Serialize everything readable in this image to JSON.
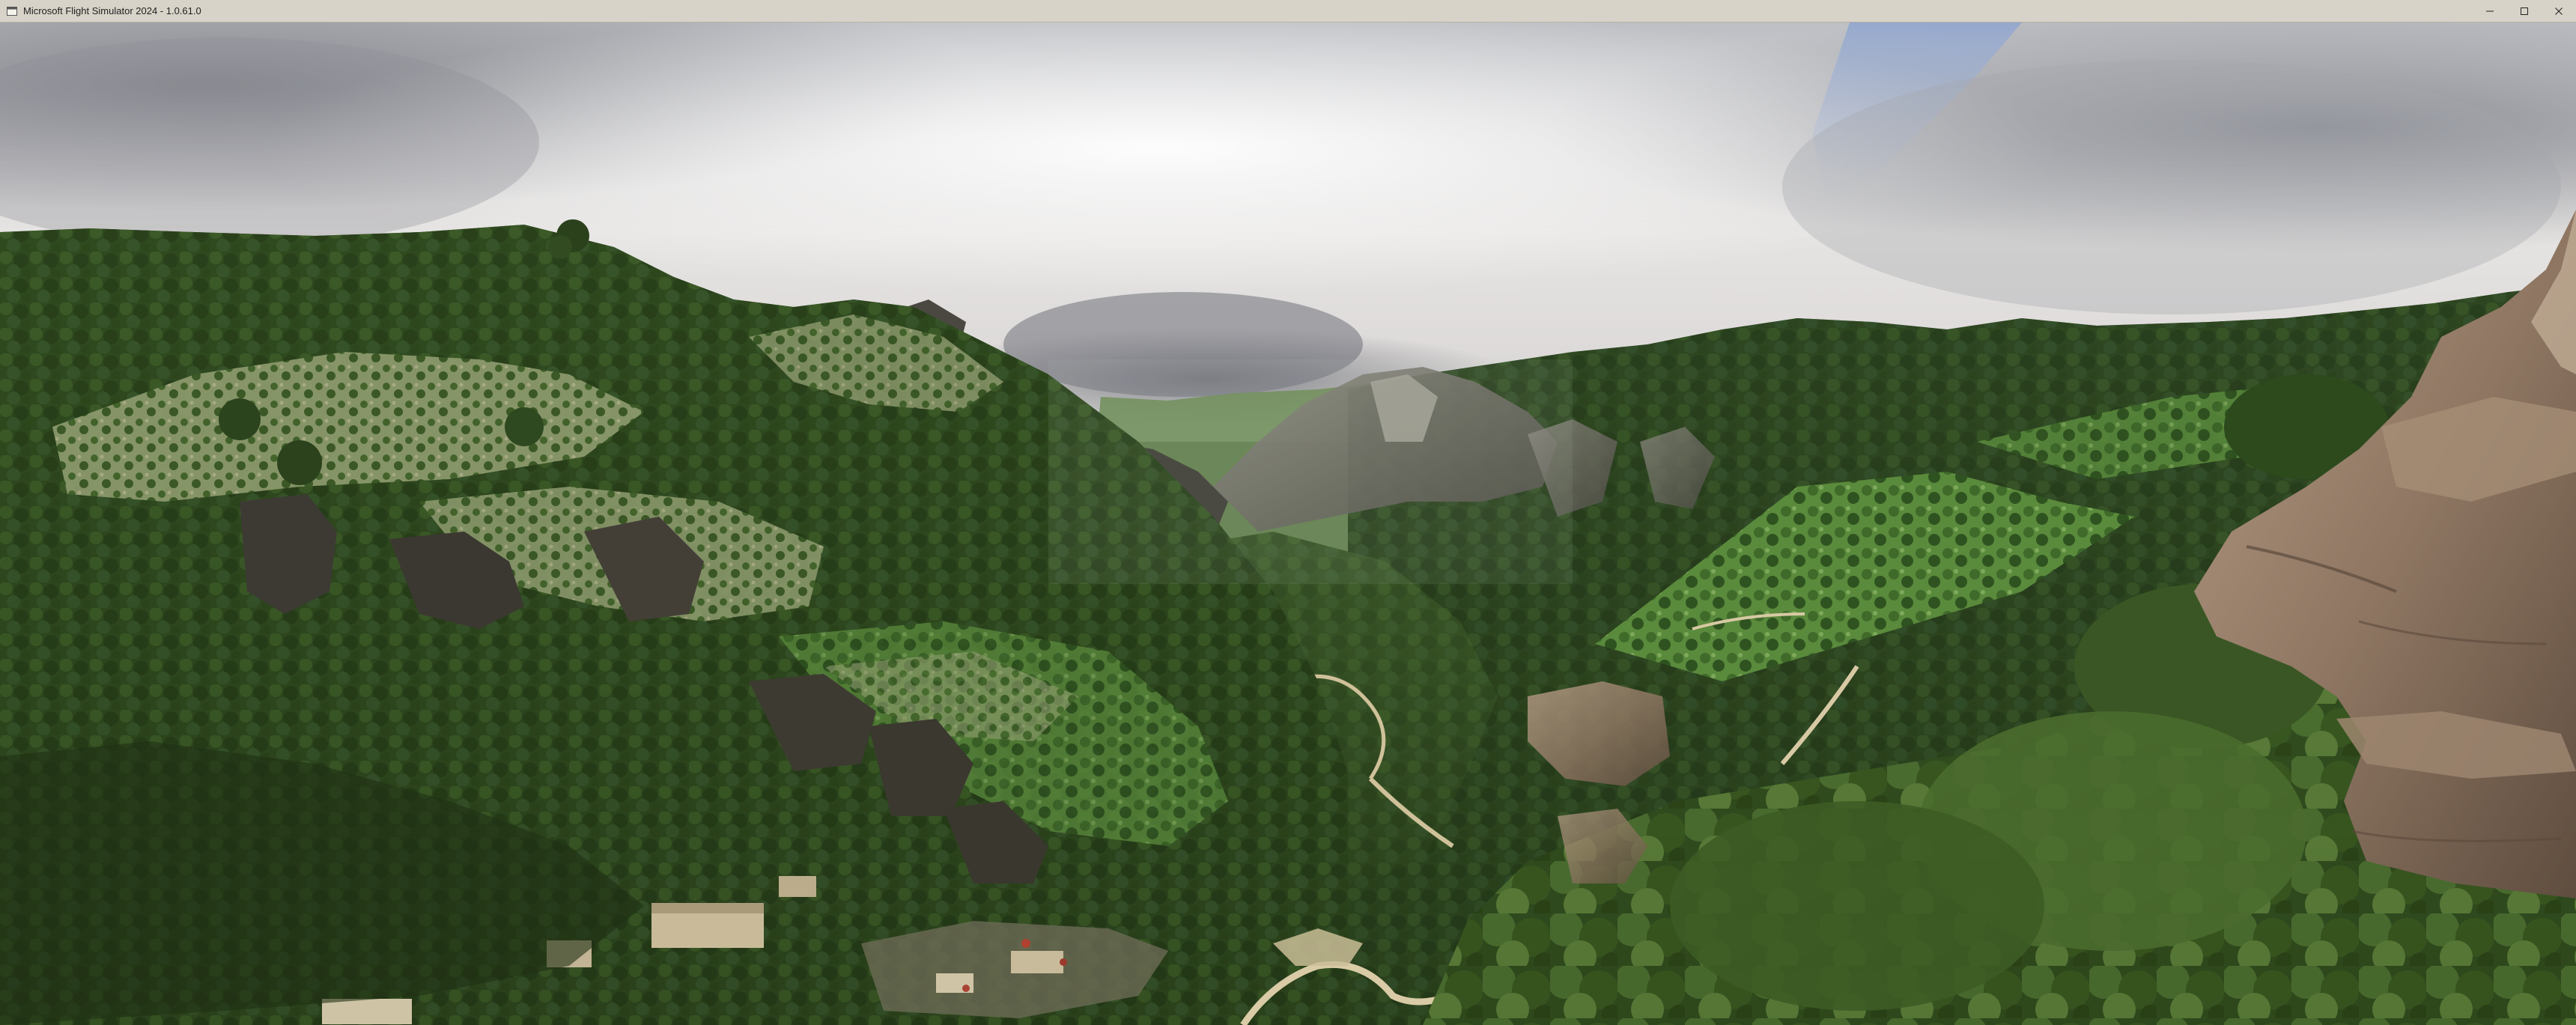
{
  "window": {
    "title": "Microsoft Flight Simulator 2024 - 1.0.61.0",
    "app_icon": "app-icon",
    "controls": [
      "minimize-icon",
      "maximize-icon",
      "close-icon"
    ]
  },
  "scene": {
    "content": "3D rendered landscape: forested mountain valley with rocky cliffs under a cloudy sky"
  }
}
